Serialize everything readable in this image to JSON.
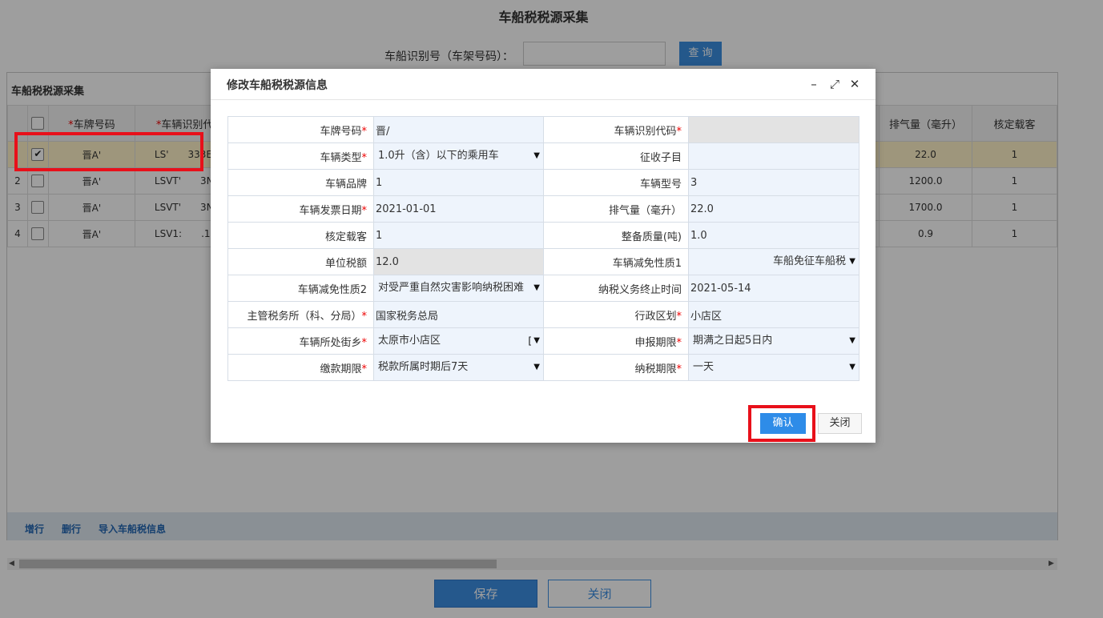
{
  "page": {
    "title": "车船税税源采集",
    "search_label": "车船识别号（车架号码）：",
    "search_value": "",
    "search_button": "查 询",
    "panel_title": "车船税税源采集",
    "columns": {
      "plate": "车牌号码",
      "vin": "车辆识别代",
      "displacement": "排气量（毫升）",
      "seats": "核定载客",
      "required_mark": "*"
    },
    "rows": [
      {
        "num": "",
        "checked": "✔",
        "plate": "晋A'",
        "vin1": "LS'",
        "vin2": "333E",
        "displacement": "22.0",
        "seats": "1"
      },
      {
        "num": "2",
        "checked": "",
        "plate": "晋A'",
        "vin1": "LSVT'",
        "vin2": "3N",
        "displacement": "1200.0",
        "seats": "1"
      },
      {
        "num": "3",
        "checked": "",
        "plate": "晋A'",
        "vin1": "LSVT'",
        "vin2": "3N",
        "displacement": "1700.0",
        "seats": "1"
      },
      {
        "num": "4",
        "checked": "",
        "plate": "晋A'",
        "vin1": "LSV1:",
        "vin2": ".1:",
        "displacement": "0.9",
        "seats": "1"
      }
    ],
    "footer_links": {
      "add": "增行",
      "delete": "删行",
      "import": "导入车船税信息"
    },
    "save_button": "保存",
    "close_button": "关闭",
    "scroll_left": "◀",
    "scroll_right": "▶"
  },
  "dialog": {
    "title": "修改车船税税源信息",
    "icons": {
      "minimize": "–",
      "maximize": "⤢",
      "close": "✕"
    },
    "required_mark": "*",
    "fields": {
      "plate_label": "车牌号码",
      "plate_value": "晋/",
      "vin_label": "车辆识别代码",
      "vin_value": "",
      "type_label": "车辆类型",
      "type_value": "1.0升（含）以下的乘用车",
      "subitem_label": "征收子目",
      "subitem_value": "",
      "brand_label": "车辆品牌",
      "brand_value": "1",
      "model_label": "车辆型号",
      "model_value": "3",
      "invoice_date_label": "车辆发票日期",
      "invoice_date_value": "2021-01-01",
      "displacement_label": "排气量（毫升）",
      "displacement_value": "22.0",
      "seats_label": "核定载客",
      "seats_value": "1",
      "curb_weight_label": "整备质量(吨)",
      "curb_weight_value": "1.0",
      "unit_tax_label": "单位税额",
      "unit_tax_value": "12.0",
      "exempt1_label": "车辆减免性质1",
      "exempt1_value": "车船免征车船税",
      "exempt2_label": "车辆减免性质2",
      "exempt2_value": "对受严重自然灾害影响纳税困难",
      "end_date_label": "纳税义务终止时间",
      "end_date_value": "2021-05-14",
      "office_label": "主管税务所（科、分局）",
      "office_value": "国家税务总局",
      "district_label": "行政区划",
      "district_value": "小店区",
      "street_label": "车辆所处街乡",
      "street_value": "太原市小店区",
      "street_extra": "[",
      "report_label": "申报期限",
      "report_value": "期满之日起5日内",
      "payment_label": "缴款期限",
      "payment_value": "税款所属时期后7天",
      "tax_period_label": "纳税期限",
      "tax_period_value": "一天"
    },
    "caret": "▼",
    "confirm_button": "确认",
    "close_button": "关闭"
  },
  "colors": {
    "accent": "#3c8ee2",
    "highlight": "#e8101a",
    "selected_row": "#fff3c8"
  }
}
